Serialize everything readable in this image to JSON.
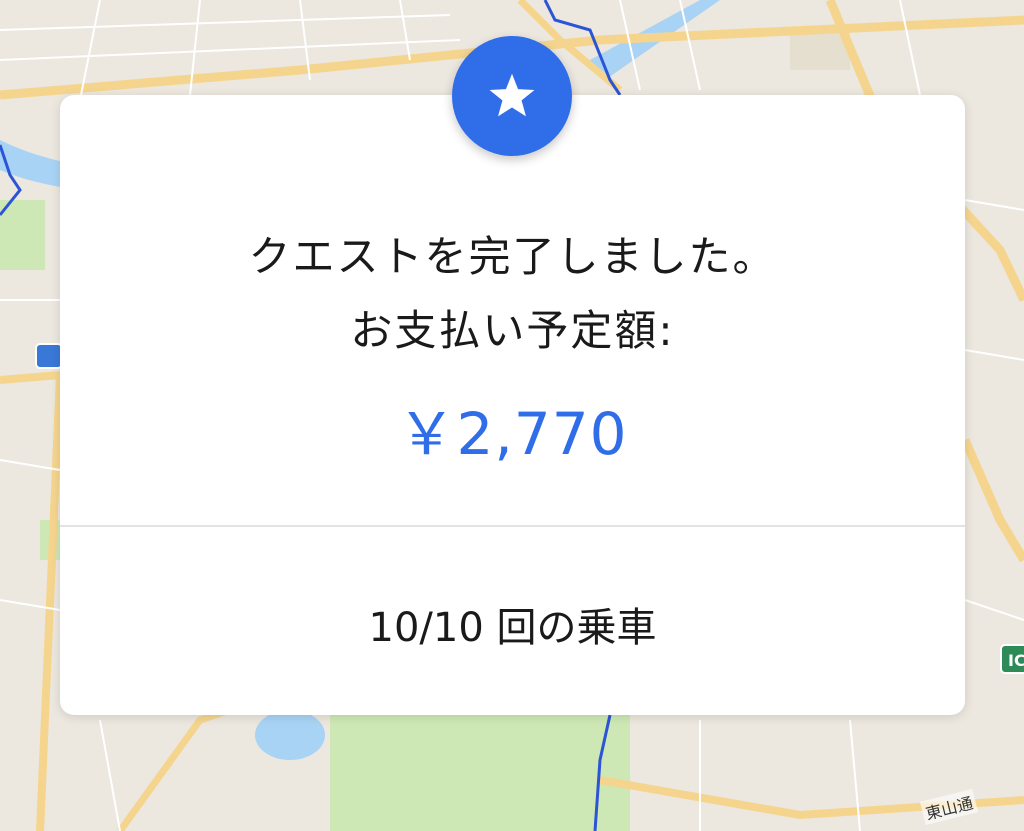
{
  "map": {
    "road_label": "東山通",
    "highway_sign": "IC",
    "colors": {
      "background": "#ECE7DF",
      "road": "#F5D58E",
      "minor_road": "#FFFFFF",
      "park": "#CDE8B5",
      "water": "#A9D3F5",
      "boundary": "#2B55D6"
    }
  },
  "modal": {
    "badge_icon": "star-icon",
    "line1": "クエストを完了しました。",
    "line2": "お支払い予定額:",
    "amount": "￥2,770",
    "rides": "10/10 回の乗車",
    "accent_color": "#2F6EE8"
  }
}
